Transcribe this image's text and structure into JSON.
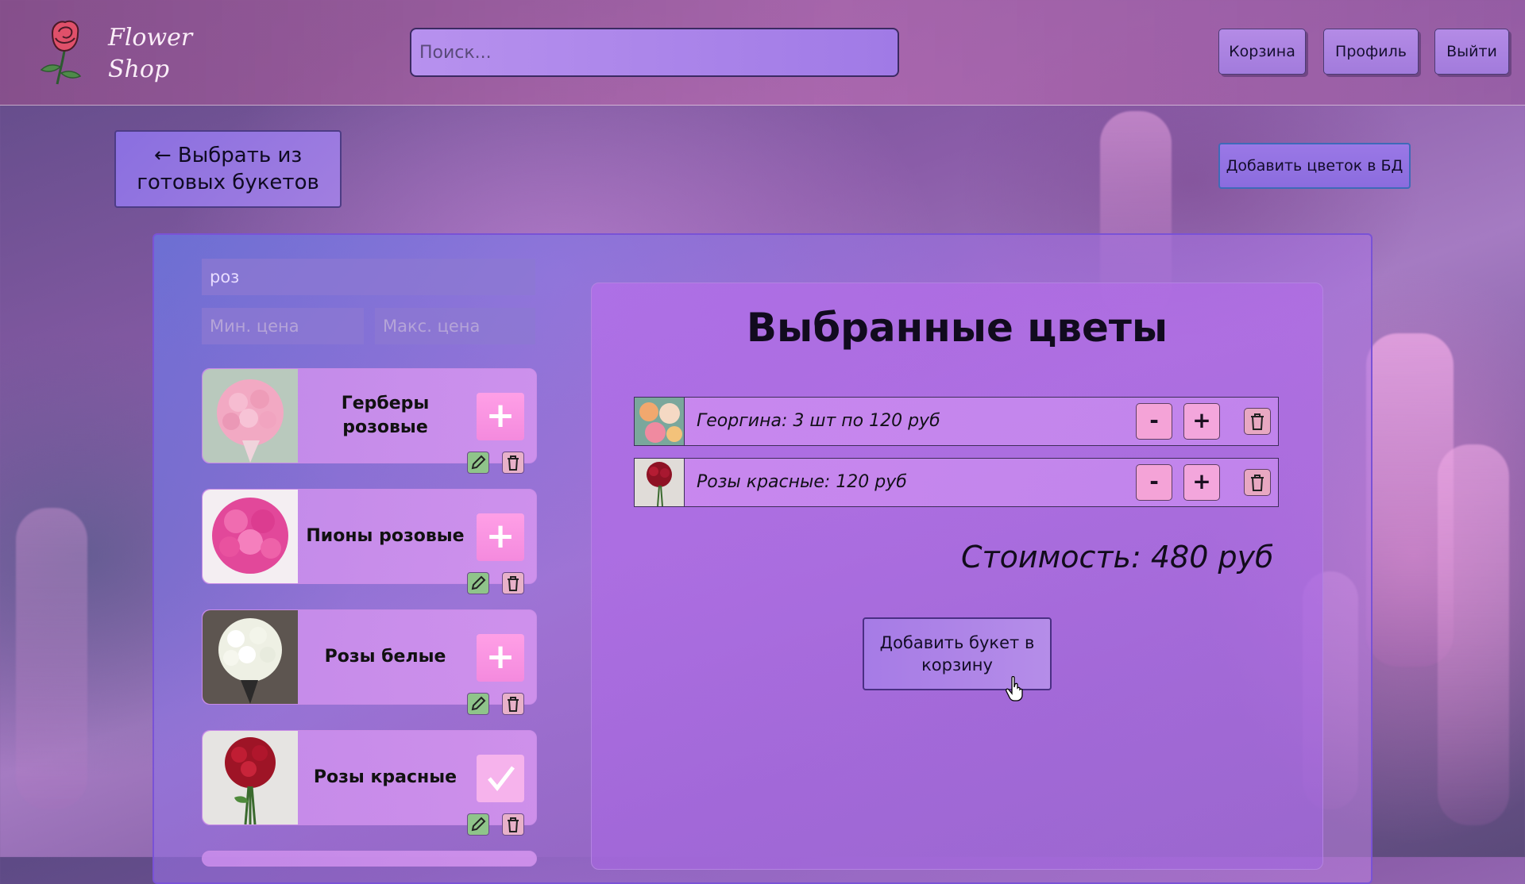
{
  "header": {
    "logo_text_line1": "Flower",
    "logo_text_line2": "Shop",
    "search_placeholder": "Поиск...",
    "buttons": {
      "cart": "Корзина",
      "profile": "Профиль",
      "logout": "Выйти"
    }
  },
  "back_button": {
    "line1": "← Выбрать из",
    "line2": "готовых букетов"
  },
  "add_flower_db_button": "Добавить цветок в БД",
  "filters": {
    "name_value": "роз",
    "min_price_placeholder": "Мин. цена",
    "max_price_placeholder": "Макс. цена"
  },
  "flower_cards": [
    {
      "name": "Герберы розовые",
      "selected": false,
      "action_icon": "plus-icon"
    },
    {
      "name": "Пионы розовые",
      "selected": false,
      "action_icon": "plus-icon"
    },
    {
      "name": "Розы белые",
      "selected": false,
      "action_icon": "plus-icon"
    },
    {
      "name": "Розы красные",
      "selected": true,
      "action_icon": "check-icon"
    }
  ],
  "selected_panel": {
    "title": "Выбранные цветы",
    "items": [
      {
        "text": "Георгина: 3 шт по 120 руб",
        "minus": "-",
        "plus": "+"
      },
      {
        "text": "Розы красные: 120 руб",
        "minus": "-",
        "plus": "+"
      }
    ],
    "cost": "Стоимость: 480 руб",
    "add_to_cart_line1": "Добавить букет в",
    "add_to_cart_line2": "корзину"
  },
  "colors": {
    "accent_pink": "#f48ade",
    "panel_border": "#7a52d6",
    "button_purple": "#a27bdc"
  }
}
